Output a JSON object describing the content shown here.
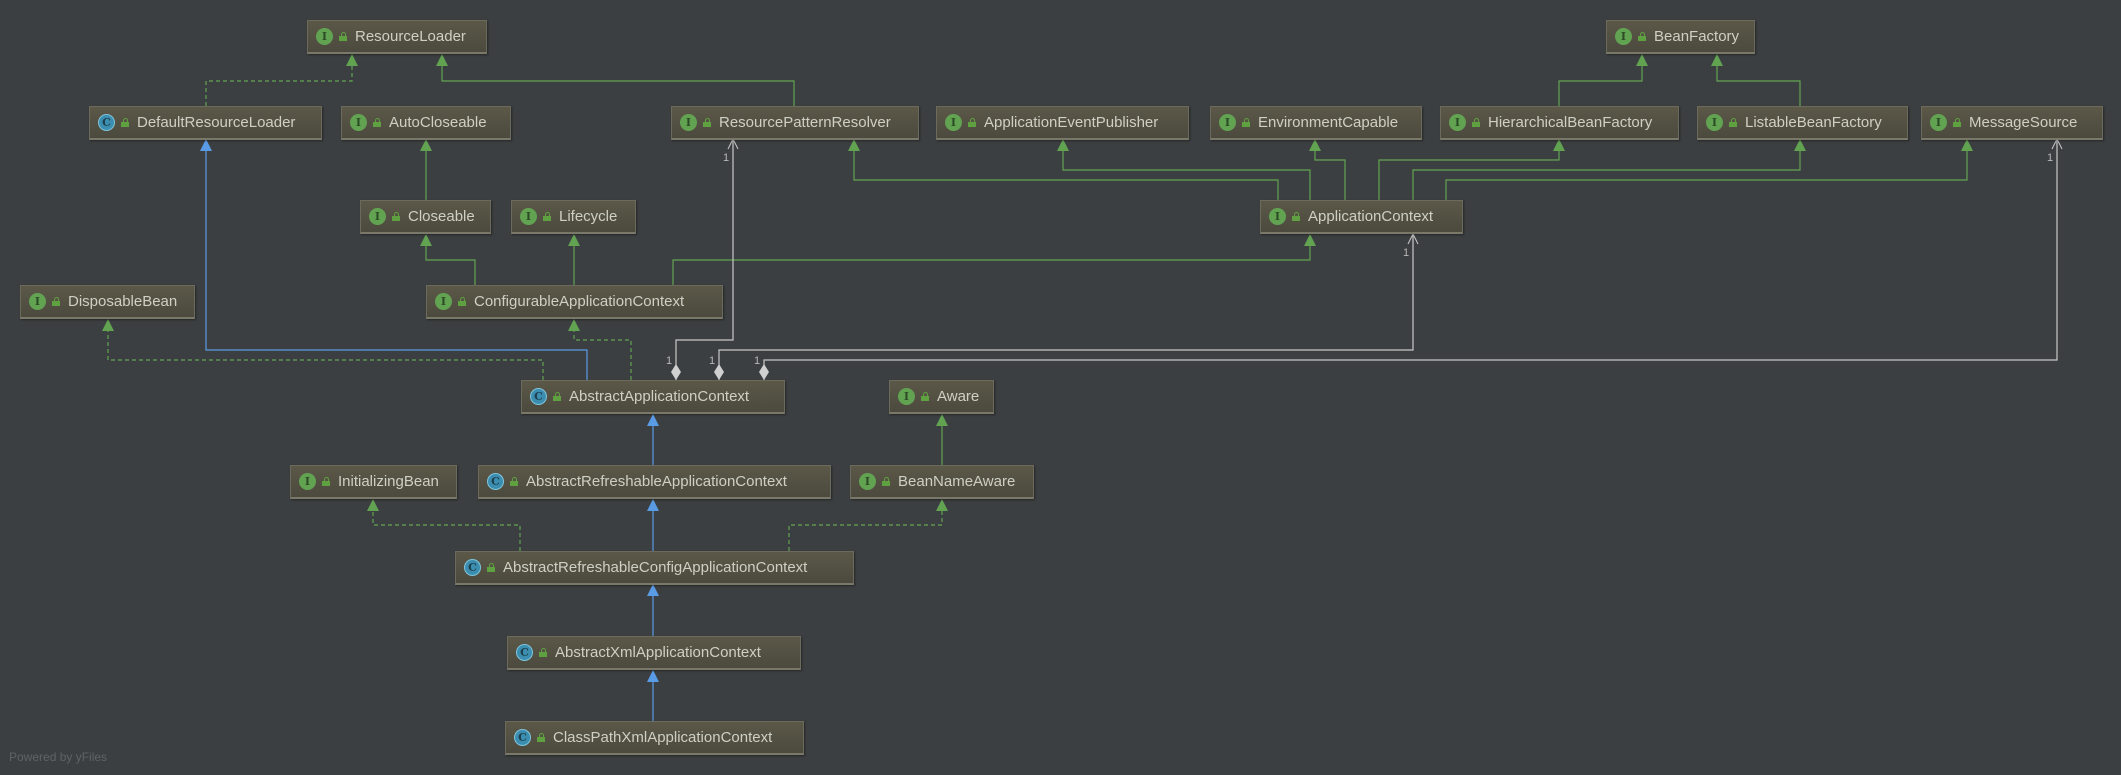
{
  "nodes": [
    {
      "name": "ResourceLoader",
      "kind": "interface",
      "badge": "I"
    },
    {
      "name": "BeanFactory",
      "kind": "interface",
      "badge": "I"
    },
    {
      "name": "DefaultResourceLoader",
      "kind": "class",
      "badge": "C"
    },
    {
      "name": "AutoCloseable",
      "kind": "interface",
      "badge": "I"
    },
    {
      "name": "ResourcePatternResolver",
      "kind": "interface",
      "badge": "I"
    },
    {
      "name": "ApplicationEventPublisher",
      "kind": "interface",
      "badge": "I"
    },
    {
      "name": "EnvironmentCapable",
      "kind": "interface",
      "badge": "I"
    },
    {
      "name": "HierarchicalBeanFactory",
      "kind": "interface",
      "badge": "I"
    },
    {
      "name": "ListableBeanFactory",
      "kind": "interface",
      "badge": "I"
    },
    {
      "name": "MessageSource",
      "kind": "interface",
      "badge": "I"
    },
    {
      "name": "Closeable",
      "kind": "interface",
      "badge": "I"
    },
    {
      "name": "Lifecycle",
      "kind": "interface",
      "badge": "I"
    },
    {
      "name": "ApplicationContext",
      "kind": "interface",
      "badge": "I"
    },
    {
      "name": "DisposableBean",
      "kind": "interface",
      "badge": "I"
    },
    {
      "name": "ConfigurableApplicationContext",
      "kind": "interface",
      "badge": "I"
    },
    {
      "name": "AbstractApplicationContext",
      "kind": "class",
      "badge": "C"
    },
    {
      "name": "Aware",
      "kind": "interface",
      "badge": "I"
    },
    {
      "name": "InitializingBean",
      "kind": "interface",
      "badge": "I"
    },
    {
      "name": "AbstractRefreshableApplicationContext",
      "kind": "class",
      "badge": "C"
    },
    {
      "name": "BeanNameAware",
      "kind": "interface",
      "badge": "I"
    },
    {
      "name": "AbstractRefreshableConfigApplicationContext",
      "kind": "class",
      "badge": "C"
    },
    {
      "name": "AbstractXmlApplicationContext",
      "kind": "class",
      "badge": "C"
    },
    {
      "name": "ClassPathXmlApplicationContext",
      "kind": "class",
      "badge": "C"
    }
  ],
  "edges": [
    {
      "from": "DefaultResourceLoader",
      "to": "ResourceLoader",
      "type": "implements"
    },
    {
      "from": "ResourcePatternResolver",
      "to": "ResourceLoader",
      "type": "extends-interface"
    },
    {
      "from": "Closeable",
      "to": "AutoCloseable",
      "type": "extends-interface"
    },
    {
      "from": "ConfigurableApplicationContext",
      "to": "Closeable",
      "type": "extends-interface"
    },
    {
      "from": "ConfigurableApplicationContext",
      "to": "Lifecycle",
      "type": "extends-interface"
    },
    {
      "from": "ConfigurableApplicationContext",
      "to": "ApplicationContext",
      "type": "extends-interface"
    },
    {
      "from": "AbstractApplicationContext",
      "to": "ConfigurableApplicationContext",
      "type": "implements"
    },
    {
      "from": "AbstractApplicationContext",
      "to": "DisposableBean",
      "type": "implements"
    },
    {
      "from": "AbstractApplicationContext",
      "to": "DefaultResourceLoader",
      "type": "extends"
    },
    {
      "from": "AbstractApplicationContext",
      "to": "ResourcePatternResolver",
      "type": "aggregation",
      "multiplicity": "1"
    },
    {
      "from": "AbstractApplicationContext",
      "to": "ApplicationContext",
      "type": "aggregation",
      "multiplicity": "1"
    },
    {
      "from": "AbstractApplicationContext",
      "to": "MessageSource",
      "type": "aggregation",
      "multiplicity": "1"
    },
    {
      "from": "ApplicationContext",
      "to": "ResourcePatternResolver",
      "type": "extends-interface"
    },
    {
      "from": "ApplicationContext",
      "to": "ApplicationEventPublisher",
      "type": "extends-interface"
    },
    {
      "from": "ApplicationContext",
      "to": "EnvironmentCapable",
      "type": "extends-interface"
    },
    {
      "from": "ApplicationContext",
      "to": "HierarchicalBeanFactory",
      "type": "extends-interface"
    },
    {
      "from": "ApplicationContext",
      "to": "ListableBeanFactory",
      "type": "extends-interface"
    },
    {
      "from": "ApplicationContext",
      "to": "MessageSource",
      "type": "extends-interface"
    },
    {
      "from": "HierarchicalBeanFactory",
      "to": "BeanFactory",
      "type": "extends-interface"
    },
    {
      "from": "ListableBeanFactory",
      "to": "BeanFactory",
      "type": "extends-interface"
    },
    {
      "from": "AbstractRefreshableApplicationContext",
      "to": "AbstractApplicationContext",
      "type": "extends"
    },
    {
      "from": "BeanNameAware",
      "to": "Aware",
      "type": "extends-interface"
    },
    {
      "from": "AbstractRefreshableConfigApplicationContext",
      "to": "AbstractRefreshableApplicationContext",
      "type": "extends"
    },
    {
      "from": "AbstractRefreshableConfigApplicationContext",
      "to": "InitializingBean",
      "type": "implements"
    },
    {
      "from": "AbstractRefreshableConfigApplicationContext",
      "to": "BeanNameAware",
      "type": "implements"
    },
    {
      "from": "AbstractXmlApplicationContext",
      "to": "AbstractRefreshableConfigApplicationContext",
      "type": "extends"
    },
    {
      "from": "ClassPathXmlApplicationContext",
      "to": "AbstractXmlApplicationContext",
      "type": "extends"
    }
  ],
  "colors": {
    "background": "#3c3f41",
    "interface_edge": "#62a352",
    "class_edge": "#5a9be6",
    "aggregation": "#c8c8c8",
    "interface_badge": "#62a352",
    "class_badge": "#3c8eb0"
  },
  "footer": "Powered by yFiles"
}
